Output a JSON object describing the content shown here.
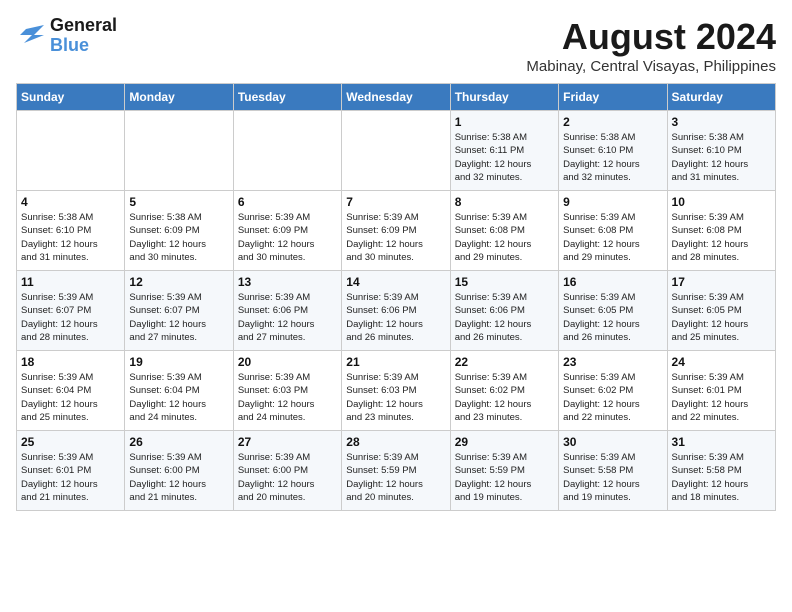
{
  "header": {
    "logo_line1": "General",
    "logo_line2": "Blue",
    "month_year": "August 2024",
    "location": "Mabinay, Central Visayas, Philippines"
  },
  "weekdays": [
    "Sunday",
    "Monday",
    "Tuesday",
    "Wednesday",
    "Thursday",
    "Friday",
    "Saturday"
  ],
  "weeks": [
    [
      {
        "day": "",
        "info": ""
      },
      {
        "day": "",
        "info": ""
      },
      {
        "day": "",
        "info": ""
      },
      {
        "day": "",
        "info": ""
      },
      {
        "day": "1",
        "info": "Sunrise: 5:38 AM\nSunset: 6:11 PM\nDaylight: 12 hours\nand 32 minutes."
      },
      {
        "day": "2",
        "info": "Sunrise: 5:38 AM\nSunset: 6:10 PM\nDaylight: 12 hours\nand 32 minutes."
      },
      {
        "day": "3",
        "info": "Sunrise: 5:38 AM\nSunset: 6:10 PM\nDaylight: 12 hours\nand 31 minutes."
      }
    ],
    [
      {
        "day": "4",
        "info": "Sunrise: 5:38 AM\nSunset: 6:10 PM\nDaylight: 12 hours\nand 31 minutes."
      },
      {
        "day": "5",
        "info": "Sunrise: 5:38 AM\nSunset: 6:09 PM\nDaylight: 12 hours\nand 30 minutes."
      },
      {
        "day": "6",
        "info": "Sunrise: 5:39 AM\nSunset: 6:09 PM\nDaylight: 12 hours\nand 30 minutes."
      },
      {
        "day": "7",
        "info": "Sunrise: 5:39 AM\nSunset: 6:09 PM\nDaylight: 12 hours\nand 30 minutes."
      },
      {
        "day": "8",
        "info": "Sunrise: 5:39 AM\nSunset: 6:08 PM\nDaylight: 12 hours\nand 29 minutes."
      },
      {
        "day": "9",
        "info": "Sunrise: 5:39 AM\nSunset: 6:08 PM\nDaylight: 12 hours\nand 29 minutes."
      },
      {
        "day": "10",
        "info": "Sunrise: 5:39 AM\nSunset: 6:08 PM\nDaylight: 12 hours\nand 28 minutes."
      }
    ],
    [
      {
        "day": "11",
        "info": "Sunrise: 5:39 AM\nSunset: 6:07 PM\nDaylight: 12 hours\nand 28 minutes."
      },
      {
        "day": "12",
        "info": "Sunrise: 5:39 AM\nSunset: 6:07 PM\nDaylight: 12 hours\nand 27 minutes."
      },
      {
        "day": "13",
        "info": "Sunrise: 5:39 AM\nSunset: 6:06 PM\nDaylight: 12 hours\nand 27 minutes."
      },
      {
        "day": "14",
        "info": "Sunrise: 5:39 AM\nSunset: 6:06 PM\nDaylight: 12 hours\nand 26 minutes."
      },
      {
        "day": "15",
        "info": "Sunrise: 5:39 AM\nSunset: 6:06 PM\nDaylight: 12 hours\nand 26 minutes."
      },
      {
        "day": "16",
        "info": "Sunrise: 5:39 AM\nSunset: 6:05 PM\nDaylight: 12 hours\nand 26 minutes."
      },
      {
        "day": "17",
        "info": "Sunrise: 5:39 AM\nSunset: 6:05 PM\nDaylight: 12 hours\nand 25 minutes."
      }
    ],
    [
      {
        "day": "18",
        "info": "Sunrise: 5:39 AM\nSunset: 6:04 PM\nDaylight: 12 hours\nand 25 minutes."
      },
      {
        "day": "19",
        "info": "Sunrise: 5:39 AM\nSunset: 6:04 PM\nDaylight: 12 hours\nand 24 minutes."
      },
      {
        "day": "20",
        "info": "Sunrise: 5:39 AM\nSunset: 6:03 PM\nDaylight: 12 hours\nand 24 minutes."
      },
      {
        "day": "21",
        "info": "Sunrise: 5:39 AM\nSunset: 6:03 PM\nDaylight: 12 hours\nand 23 minutes."
      },
      {
        "day": "22",
        "info": "Sunrise: 5:39 AM\nSunset: 6:02 PM\nDaylight: 12 hours\nand 23 minutes."
      },
      {
        "day": "23",
        "info": "Sunrise: 5:39 AM\nSunset: 6:02 PM\nDaylight: 12 hours\nand 22 minutes."
      },
      {
        "day": "24",
        "info": "Sunrise: 5:39 AM\nSunset: 6:01 PM\nDaylight: 12 hours\nand 22 minutes."
      }
    ],
    [
      {
        "day": "25",
        "info": "Sunrise: 5:39 AM\nSunset: 6:01 PM\nDaylight: 12 hours\nand 21 minutes."
      },
      {
        "day": "26",
        "info": "Sunrise: 5:39 AM\nSunset: 6:00 PM\nDaylight: 12 hours\nand 21 minutes."
      },
      {
        "day": "27",
        "info": "Sunrise: 5:39 AM\nSunset: 6:00 PM\nDaylight: 12 hours\nand 20 minutes."
      },
      {
        "day": "28",
        "info": "Sunrise: 5:39 AM\nSunset: 5:59 PM\nDaylight: 12 hours\nand 20 minutes."
      },
      {
        "day": "29",
        "info": "Sunrise: 5:39 AM\nSunset: 5:59 PM\nDaylight: 12 hours\nand 19 minutes."
      },
      {
        "day": "30",
        "info": "Sunrise: 5:39 AM\nSunset: 5:58 PM\nDaylight: 12 hours\nand 19 minutes."
      },
      {
        "day": "31",
        "info": "Sunrise: 5:39 AM\nSunset: 5:58 PM\nDaylight: 12 hours\nand 18 minutes."
      }
    ]
  ]
}
